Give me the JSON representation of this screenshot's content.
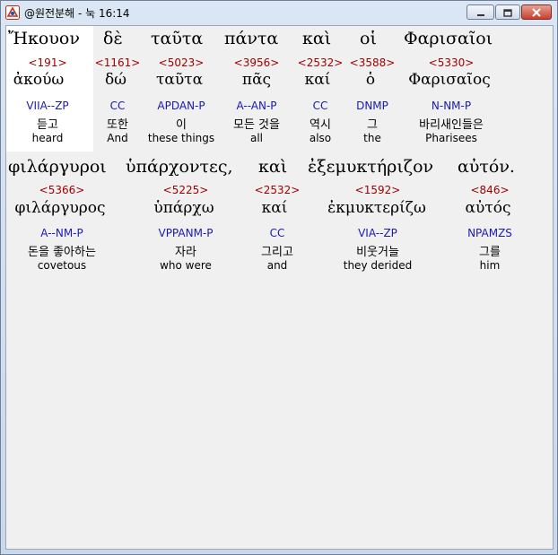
{
  "window": {
    "title": "@원전분해 - 눅 16:14",
    "controls": {
      "minimize": "minimize",
      "maximize": "maximize",
      "close": "close"
    }
  },
  "verse": {
    "lines": [
      {
        "words": [
          {
            "greek": "Ἤκουον",
            "strong": "<191>",
            "lemma": "ἀκούω",
            "morph": "VIIA--ZP",
            "korean": "듣고",
            "english": "heard"
          },
          {
            "greek": "δὲ",
            "strong": "<1161>",
            "lemma": "δώ",
            "morph": "CC",
            "korean": "또한",
            "english": "And"
          },
          {
            "greek": "ταῦτα",
            "strong": "<5023>",
            "lemma": "ταῦτα",
            "morph": "APDAN-P",
            "korean": "이",
            "english": "these things"
          },
          {
            "greek": "πάντα",
            "strong": "<3956>",
            "lemma": "πᾶς",
            "morph": "A--AN-P",
            "korean": "모든 것을",
            "english": "all"
          },
          {
            "greek": "καὶ",
            "strong": "<2532>",
            "lemma": "καί",
            "morph": "CC",
            "korean": "역시",
            "english": "also"
          },
          {
            "greek": "οἱ",
            "strong": "<3588>",
            "lemma": "ὁ",
            "morph": "DNMP",
            "korean": "그",
            "english": "the"
          },
          {
            "greek": "Φαρισαῖοι",
            "strong": "<5330>",
            "lemma": "Φαρισαῖος",
            "morph": "N-NM-P",
            "korean": "바리새인들은",
            "english": "Pharisees"
          }
        ]
      },
      {
        "words": [
          {
            "greek": "φιλάργυροι",
            "strong": "<5366>",
            "lemma": "φιλάργυρος",
            "morph": "A--NM-P",
            "korean": "돈을 좋아하는",
            "english": "covetous"
          },
          {
            "greek": "ὑπάρχοντες,",
            "strong": "<5225>",
            "lemma": "ὑπάρχω",
            "morph": "VPPANM-P",
            "korean": "자라",
            "english": "who were"
          },
          {
            "greek": "καὶ",
            "strong": "<2532>",
            "lemma": "καί",
            "morph": "CC",
            "korean": "그리고",
            "english": "and"
          },
          {
            "greek": "ἐξεμυκτήριζον",
            "strong": "<1592>",
            "lemma": "ἐκμυκτερίζω",
            "morph": "VIA--ZP",
            "korean": "비웃거늘",
            "english": "they derided"
          },
          {
            "greek": "αὐτόν.",
            "strong": "<846>",
            "lemma": "αὐτός",
            "morph": "NPAMZS",
            "korean": "그를",
            "english": "him"
          }
        ]
      }
    ]
  },
  "colors": {
    "strong": "#a00000",
    "morph": "#1a1ab0",
    "text": "#000000",
    "highlight": "#ffffff"
  }
}
